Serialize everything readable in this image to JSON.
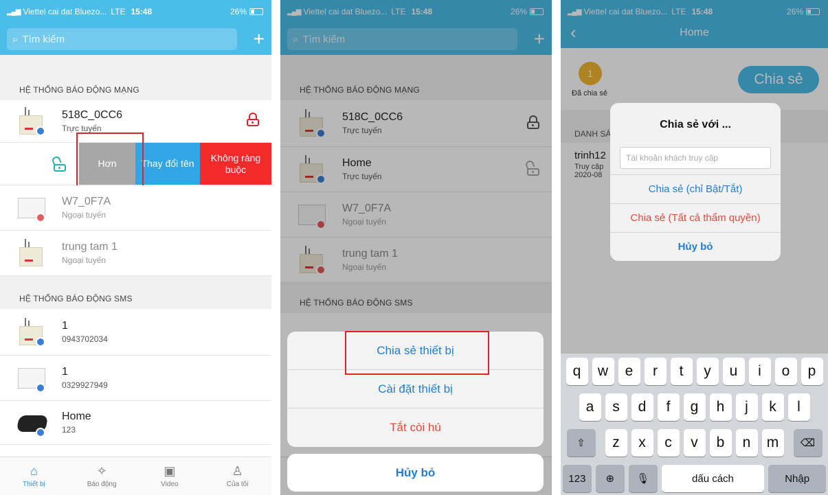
{
  "status": {
    "carrier": "Viettel cai dat Bluezo...",
    "network": "LTE",
    "time": "15:48",
    "battery": "26%"
  },
  "search": {
    "placeholder": "Tìm kiếm",
    "add": "+"
  },
  "sections": {
    "network": "HỆ THỐNG BÁO ĐỘNG MẠNG",
    "sms": "HỆ THỐNG BÁO ĐỘNG SMS"
  },
  "devices": [
    {
      "name": "518C_0CC6",
      "status": "Trực tuyến"
    },
    {
      "name": "Home",
      "status": "Trực tuyến"
    },
    {
      "name": "W7_0F7A",
      "status": "Ngoại tuyến"
    },
    {
      "name": "trung tam 1",
      "status": "Ngoại tuyến"
    }
  ],
  "sms_devices": [
    {
      "name": "1",
      "status": "0943702034"
    },
    {
      "name": "1",
      "status": "0329927949"
    },
    {
      "name": "Home",
      "status": "123"
    }
  ],
  "swipe_actions": {
    "more": "Hơn",
    "rename": "Thay đổi tên",
    "unbind": "Không ràng buộc"
  },
  "tabs": [
    "Thiết bị",
    "Báo động",
    "Video",
    "Của tôi"
  ],
  "sheet": {
    "share": "Chia sẻ thiết bị",
    "settings": "Cài đặt thiết bị",
    "siren_off": "Tắt còi hú",
    "cancel": "Hủy bỏ"
  },
  "screen3": {
    "title": "Home",
    "shared_count": "1",
    "shared_label": "Đã chia sẻ",
    "share_button": "Chia sẻ",
    "list_header": "DANH SÁ",
    "entry_name": "trinh12",
    "entry_line1": "Truy cập",
    "entry_line2": "2020-08",
    "alert_title": "Chia sẻ với ...",
    "alert_placeholder": "Tài khoản khách truy cập",
    "share_onoff": "Chia sẻ (chỉ Bật/Tắt)",
    "share_all": "Chia sẻ (Tất cả thẩm quyền)",
    "cancel": "Hủy bỏ"
  },
  "keyboard": {
    "row1": [
      "q",
      "w",
      "e",
      "r",
      "t",
      "y",
      "u",
      "i",
      "o",
      "p"
    ],
    "row2": [
      "a",
      "s",
      "d",
      "f",
      "g",
      "h",
      "j",
      "k",
      "l"
    ],
    "row3": [
      "z",
      "x",
      "c",
      "v",
      "b",
      "n",
      "m"
    ],
    "num": "123",
    "space": "dấu cách",
    "enter": "Nhập"
  },
  "colors": {
    "accent": "#4bbde9",
    "danger": "#f32a2a",
    "link": "#1f7fd6"
  }
}
